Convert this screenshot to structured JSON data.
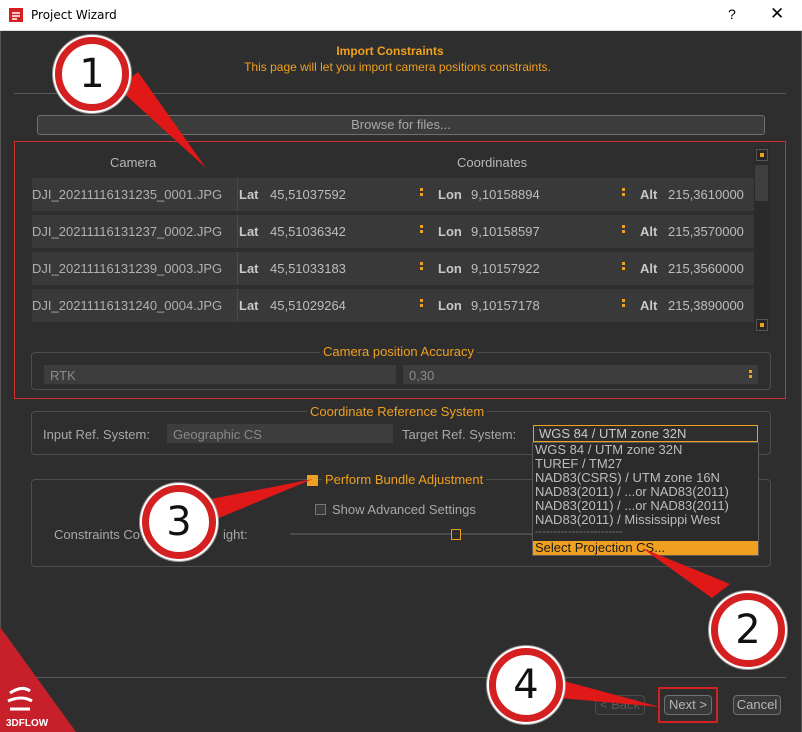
{
  "window": {
    "title": "Project Wizard",
    "help_glyph": "?",
    "close_glyph": "✕"
  },
  "header": {
    "title": "Import Constraints",
    "subtitle": "This page will let you import camera positions constraints."
  },
  "browse_label": "Browse for files...",
  "table": {
    "headers": {
      "camera": "Camera",
      "coordinates": "Coordinates"
    },
    "rows": [
      {
        "camera": "DJI_20211116131235_0001.JPG",
        "lat_label": "Lat",
        "lat": "45,51037592",
        "lon_label": "Lon",
        "lon": "9,10158894",
        "alt_label": "Alt",
        "alt": "215,3610000"
      },
      {
        "camera": "DJI_20211116131237_0002.JPG",
        "lat_label": "Lat",
        "lat": "45,51036342",
        "lon_label": "Lon",
        "lon": "9,10158597",
        "alt_label": "Alt",
        "alt": "215,3570000"
      },
      {
        "camera": "DJI_20211116131239_0003.JPG",
        "lat_label": "Lat",
        "lat": "45,51033183",
        "lon_label": "Lon",
        "lon": "9,10157922",
        "alt_label": "Alt",
        "alt": "215,3560000"
      },
      {
        "camera": "DJI_20211116131240_0004.JPG",
        "lat_label": "Lat",
        "lat": "45,51029264",
        "lon_label": "Lon",
        "lon": "9,10157178",
        "alt_label": "Alt",
        "alt": "215,3890000"
      }
    ]
  },
  "accuracy": {
    "title": "Camera position Accuracy",
    "mode": "RTK",
    "value": "0,30"
  },
  "crs": {
    "title": "Coordinate Reference System",
    "input_label": "Input Ref. System:",
    "input_value": "Geographic CS",
    "target_label": "Target Ref. System:",
    "target_value": "WGS 84 / UTM zone 32N",
    "options": [
      "WGS 84 / UTM zone 32N",
      "TUREF / TM27",
      "NAD83(CSRS) / UTM zone 16N",
      "NAD83(2011) / ...or NAD83(2011)",
      "NAD83(2011) / ...or NAD83(2011)",
      "NAD83(2011) / Mississippi West"
    ],
    "separator": "------------------------",
    "select_projection": "Select Projection CS..."
  },
  "bundle": {
    "perform_label": "Perform Bundle Adjustment",
    "perform_checked": true,
    "advanced_label": "Show Advanced Settings",
    "advanced_checked": false,
    "weight_label": "Constraints Co",
    "weight_label_tail": "ight:",
    "weight_fraction": 0.68
  },
  "buttons": {
    "back": "< Back",
    "next": "Next >",
    "cancel": "Cancel"
  },
  "callouts": [
    "1",
    "2",
    "3",
    "4"
  ],
  "logo_text": "3DFLOW",
  "colors": {
    "accent": "#f0a020",
    "annotation": "#d42020",
    "background": "#2e2e2e"
  }
}
